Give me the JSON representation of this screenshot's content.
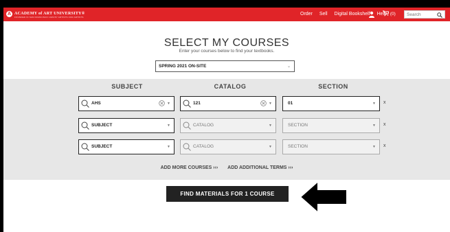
{
  "header": {
    "brand_logo": "A",
    "brand": "ACADEMY of ART UNIVERSITY®",
    "brand_sub": "FOUNDED IN SAN FRANCISCO 1929 BY ARTISTS FOR ARTISTS",
    "nav": [
      "Order",
      "Sell",
      "Digital Bookshelf",
      "Help"
    ],
    "cart": "(0)",
    "search_placeholder": "Search",
    "accent": "#e02428"
  },
  "page": {
    "title": "SELECT MY COURSES",
    "subtitle": "Enter your courses below to find your textbooks.",
    "term": "SPRING 2021 ON-SITE"
  },
  "columns": [
    "SUBJECT",
    "CATALOG",
    "SECTION"
  ],
  "rows": [
    {
      "subject": "AHS",
      "catalog": "121",
      "section": "01",
      "remove": "x"
    },
    {
      "subject": "SUBJECT",
      "catalog": "CATALOG",
      "section": "SECTION",
      "remove": "x"
    },
    {
      "subject": "SUBJECT",
      "catalog": "CATALOG",
      "section": "SECTION",
      "remove": "x"
    }
  ],
  "links": {
    "add_courses": "ADD MORE COURSES ›››",
    "add_terms": "ADD ADDITIONAL TERMS ›››"
  },
  "find_button": "FIND MATERIALS FOR 1 COURSE",
  "icons": [
    "search-icon",
    "user-icon",
    "cart-icon",
    "clear-icon",
    "chevron-down-icon",
    "arrow-left-icon"
  ]
}
